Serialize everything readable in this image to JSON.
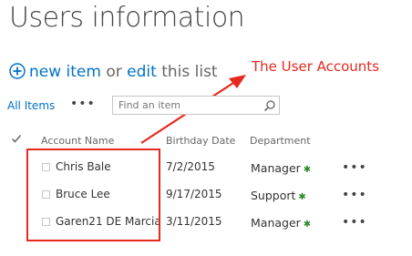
{
  "page": {
    "title": "Users information"
  },
  "commands": {
    "new_item": "new item",
    "or": "or",
    "edit": "edit",
    "this_list": "this list"
  },
  "annotation": {
    "text": "The User Accounts",
    "color": "#e8281f"
  },
  "toolbar": {
    "view": "All Items",
    "more": "•••",
    "search": {
      "placeholder": "Find an item"
    }
  },
  "list": {
    "columns": {
      "account_name": "Account Name",
      "birthday_date": "Birthday Date",
      "department": "Department"
    },
    "rows": [
      {
        "account": "Chris Bale",
        "birthday": "7/2/2015",
        "department": "Manager",
        "more": "•••"
      },
      {
        "account": "Bruce Lee",
        "birthday": "9/17/2015",
        "department": "Support",
        "more": "•••"
      },
      {
        "account": "Garen21 DE Marcia",
        "birthday": "3/11/2015",
        "department": "Manager",
        "more": "•••"
      }
    ]
  },
  "colors": {
    "link": "#0072c6",
    "highlight": "#e8281f",
    "text": "#444444"
  },
  "icons": {
    "add": "plus-circle-icon",
    "search": "magnifier-icon",
    "new_marker": "asterisk-icon",
    "select_all": "checkmark-icon"
  }
}
